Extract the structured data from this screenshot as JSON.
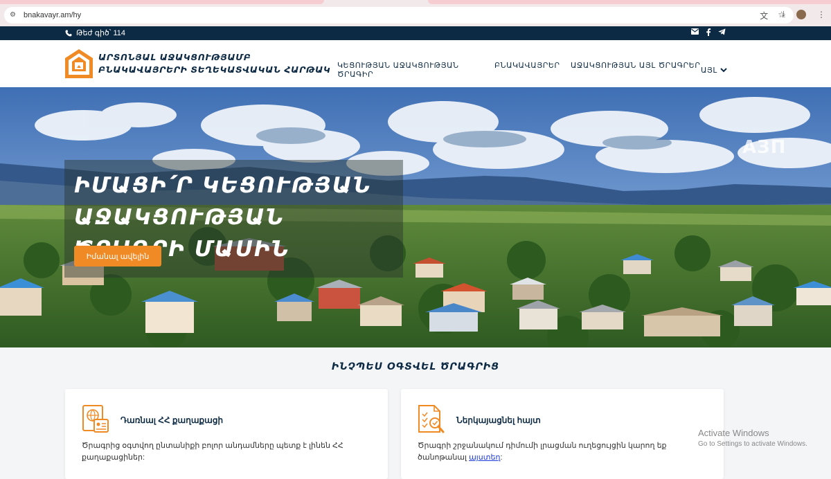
{
  "browser": {
    "url": "bnakavayr.am/hy",
    "icons": [
      "tune-icon",
      "translate-icon",
      "star-icon",
      "download-icon",
      "menu-icon"
    ]
  },
  "topbar": {
    "phone_label": "Թեժ գիծ՝ 114",
    "socials": [
      "mail-icon",
      "facebook-icon",
      "telegram-icon"
    ]
  },
  "header": {
    "logo_line1": "ԱՐՏՈՆՅԱԼ ԱՋԱԿՑՈՒԹՅԱՄԲ",
    "logo_line2": "ԲՆԱԿԱՎԱՅՐԵՐԻ ՏԵՂԵԿԱՏՎԱԿԱՆ ՀԱՐԹԱԿ",
    "nav": [
      {
        "label": "ԿԵՑՈՒԹՅԱՆ ԱՋԱԿՑՈՒԹՅԱՆ ԾՐԱԳԻՐ"
      },
      {
        "label": "ԲՆԱԿԱՎԱՅՐԵՐ"
      },
      {
        "label": "ԱՋԱԿՑՈՒԹՅԱՆ ԱՅԼ ԾՐԱԳՐԵՐ"
      },
      {
        "label": "ԱՅԼ"
      }
    ]
  },
  "hero": {
    "title_line1": "ԻՄԱՑԻ՛Ր ԿԵՑՈՒԹՅԱՆ",
    "title_line2": "ԱՋԱԿՑՈՒԹՅԱՆ ԾՐԱԳՐԻ ՄԱՍԻՆ",
    "button_label": "Իմանալ ավելին",
    "watermark": "АЗП"
  },
  "how_to": {
    "title": "ԻՆՉՊԵՍ ՕԳՏՎԵԼ ԾՐԱԳՐԻՑ",
    "cards": [
      {
        "title": "Դառնալ ՀՀ քաղաքացի",
        "text": "Ծրագրից օգտվող ընտանիքի բոլոր անդամները պետք է լինեն ՀՀ քաղաքացիներ:"
      },
      {
        "title": "Ներկայացնել հայտ",
        "text": "Ծրագրի շրջանակում դիմումի լրացման ուղեցույցին կարող եք ծանոթանալ",
        "link": "այստեղ",
        "after_link": ":"
      }
    ]
  },
  "os_overlay": {
    "line1": "Activate Windows",
    "line2": "Go to Settings to activate Windows."
  },
  "colors": {
    "navy": "#0d2a44",
    "orange": "#f08a24",
    "link": "#1a3ad8"
  }
}
